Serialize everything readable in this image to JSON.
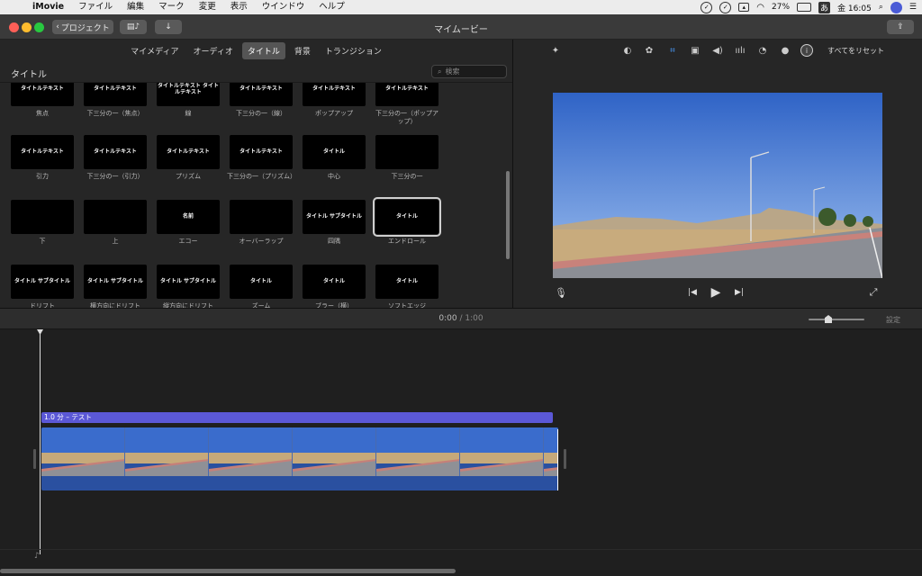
{
  "menubar": {
    "app_name": "iMovie",
    "items": [
      "ファイル",
      "編集",
      "マーク",
      "変更",
      "表示",
      "ウインドウ",
      "ヘルプ"
    ],
    "battery": "27%",
    "input_method": "あ",
    "clock": "金 16:05"
  },
  "window": {
    "title": "マイムービー",
    "back_button": "プロジェクト"
  },
  "browser": {
    "tabs": [
      "マイメディア",
      "オーディオ",
      "タイトル",
      "背景",
      "トランジション"
    ],
    "active_tab": "タイトル",
    "header": "タイトル",
    "search_placeholder": "検索",
    "tiles": [
      {
        "thumb": "タイトルテキスト",
        "caption": "焦点"
      },
      {
        "thumb": "タイトルテキスト",
        "caption": "下三分の一（焦点）"
      },
      {
        "thumb": "タイトルテキスト タイトルテキスト",
        "caption": "線"
      },
      {
        "thumb": "タイトルテキスト",
        "caption": "下三分の一（線）"
      },
      {
        "thumb": "タイトルテキスト",
        "caption": "ポップアップ"
      },
      {
        "thumb": "タイトルテキスト",
        "caption": "下三分の一（ポップアップ）"
      },
      {
        "thumb": "タイトルテキスト",
        "caption": "引力"
      },
      {
        "thumb": "タイトルテキスト",
        "caption": "下三分の一（引力）"
      },
      {
        "thumb": "タイトルテキスト",
        "caption": "プリズム"
      },
      {
        "thumb": "タイトルテキスト",
        "caption": "下三分の一（プリズム）"
      },
      {
        "thumb": "タイトル",
        "caption": "中心"
      },
      {
        "thumb": "",
        "caption": "下三分の一"
      },
      {
        "thumb": "",
        "caption": "下"
      },
      {
        "thumb": "",
        "caption": "上"
      },
      {
        "thumb": "名前",
        "caption": "エコー"
      },
      {
        "thumb": "",
        "caption": "オーバーラップ"
      },
      {
        "thumb": "タイトル サブタイトル",
        "caption": "四隅"
      },
      {
        "thumb": "タイトル",
        "caption": "エンドロール"
      },
      {
        "thumb": "タイトル サブタイトル",
        "caption": "ドリフト"
      },
      {
        "thumb": "タイトル サブタイトル",
        "caption": "横方向にドリフト"
      },
      {
        "thumb": "タイトル サブタイトル",
        "caption": "縦方向にドリフト"
      },
      {
        "thumb": "タイトル",
        "caption": "ズーム"
      },
      {
        "thumb": "タイトル",
        "caption": "ブラー（横）"
      },
      {
        "thumb": "タイトル",
        "caption": "ソフトエッジ"
      }
    ],
    "selected_tile": "エンドロール"
  },
  "viewer": {
    "reset_all": "すべてをリセット"
  },
  "timeline": {
    "current_time": "0:00",
    "separator": "/",
    "total_time": "1:00",
    "settings": "設定",
    "title_clip_label": "1.0 分 – テスト"
  },
  "colors": {
    "title_clip": "#5b58d6",
    "video_clip": "#2a50a0",
    "sky": "#3b6fcf"
  }
}
